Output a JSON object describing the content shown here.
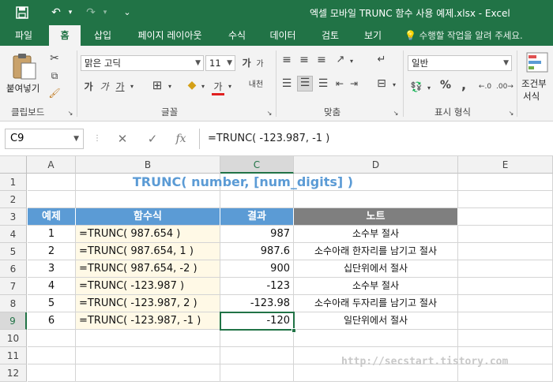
{
  "app": {
    "window_title": "엑셀 모바일 TRUNC 함수 사용 예제.xlsx - Excel",
    "brand_color": "#217346"
  },
  "quick_access": [
    {
      "name": "save-icon",
      "glyph": "💾"
    },
    {
      "name": "undo-icon",
      "glyph": "↶"
    },
    {
      "name": "redo-icon",
      "glyph": "↷"
    },
    {
      "name": "customize-qat-icon",
      "glyph": "⌄"
    }
  ],
  "ribbon_tabs": [
    {
      "label": "파일",
      "active": false
    },
    {
      "label": "홈",
      "active": true
    },
    {
      "label": "삽입",
      "active": false
    },
    {
      "label": "페이지 레이아웃",
      "active": false
    },
    {
      "label": "수식",
      "active": false
    },
    {
      "label": "데이터",
      "active": false
    },
    {
      "label": "검토",
      "active": false
    },
    {
      "label": "보기",
      "active": false
    }
  ],
  "tell_me": "수행할 작업을 알려 주세요.",
  "ribbon": {
    "clipboard": {
      "paste_label": "붙여넣기",
      "group_label": "클립보드"
    },
    "font": {
      "font_name": "맑은 고딕",
      "font_size": "11",
      "group_label": "글꼴",
      "bold": "가",
      "italic": "가",
      "underline": "가",
      "grow": "가",
      "shrink": "가",
      "font_color": "가",
      "phonetic": "내천"
    },
    "alignment": {
      "group_label": "맞춤"
    },
    "number": {
      "format": "일반",
      "group_label": "표시 형식"
    },
    "styles": {
      "conditional_label_1": "조건부",
      "conditional_label_2": "서식"
    }
  },
  "formula_bar": {
    "name_box": "C9",
    "fx_label": "fx",
    "formula": "=TRUNC( -123.987, -1 )"
  },
  "sheet": {
    "columns": [
      "A",
      "B",
      "C",
      "D",
      "E"
    ],
    "selected_column": "C",
    "rows": [
      "1",
      "2",
      "3",
      "4",
      "5",
      "6",
      "7",
      "8",
      "9",
      "10",
      "11",
      "12"
    ],
    "selected_row": "9",
    "title": "TRUNC( number, [num_digits] )",
    "table_headers": [
      "예제",
      "함수식",
      "결과",
      "노트"
    ],
    "header_colors": {
      "example": "#5b9bd5",
      "formula": "#5b9bd5",
      "result": "#5b9bd5",
      "note": "#7f7f7f"
    },
    "table_rows": [
      {
        "example": "1",
        "formula": "=TRUNC( 987.654 )",
        "result": "987",
        "note": "소수부 절사"
      },
      {
        "example": "2",
        "formula": "=TRUNC( 987.654, 1 )",
        "result": "987.6",
        "note": "소수아래 한자리를 남기고 절사"
      },
      {
        "example": "3",
        "formula": "=TRUNC( 987.654, -2 )",
        "result": "900",
        "note": "십단위에서 절사"
      },
      {
        "example": "4",
        "formula": "=TRUNC( -123.987 )",
        "result": "-123",
        "note": "소수부 절사"
      },
      {
        "example": "5",
        "formula": "=TRUNC( -123.987, 2 )",
        "result": "-123.98",
        "note": "소수아래 두자리를 남기고 절사"
      },
      {
        "example": "6",
        "formula": "=TRUNC( -123.987, -1 )",
        "result": "-120",
        "note": "일단위에서 절사"
      }
    ],
    "watermark": "http://secstart.tistory.com"
  }
}
